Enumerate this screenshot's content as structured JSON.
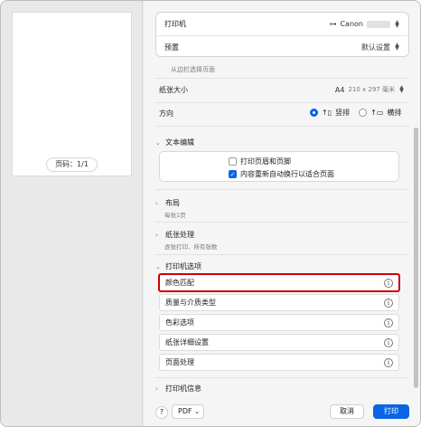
{
  "preview": {
    "page_number": "页码：1/1"
  },
  "top": {
    "printer_label": "打印机",
    "printer_value": "Canon",
    "preset_label": "预置",
    "preset_value": "默认设置"
  },
  "page": {
    "hint": "从边栏选择页面",
    "paper_size_label": "纸张大小",
    "paper_size_value": "A4",
    "paper_size_detail": "210 x 297 毫米",
    "orientation_label": "方向",
    "portrait": "竖排",
    "landscape": "横排"
  },
  "text_edit": {
    "title": "文本编辑",
    "print_headers": "打印页眉和页脚",
    "rewrap": "内容重新自动换行以适合页面"
  },
  "layout": {
    "title": "布局",
    "subtitle": "每张1页"
  },
  "paper_handling": {
    "title": "纸张处理",
    "subtitle": "逐张打印、所有张数"
  },
  "printer_options": {
    "title": "打印机选项",
    "items": [
      "颜色匹配",
      "质量与介质类型",
      "色彩选项",
      "纸张详细设置",
      "页面处理"
    ]
  },
  "printer_info": {
    "title": "打印机信息"
  },
  "bottom": {
    "help": "?",
    "pdf": "PDF",
    "cancel": "取消",
    "print": "打印"
  },
  "colors": {
    "accent": "#0a64e4",
    "highlight": "#cc0000"
  }
}
